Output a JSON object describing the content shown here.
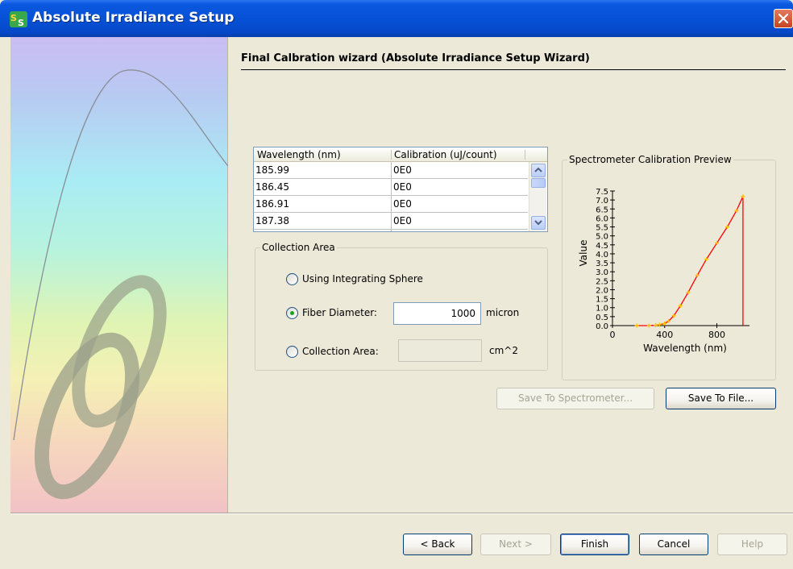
{
  "window": {
    "title": "Absolute Irradiance Setup",
    "icon": "spectrasuite-app-icon",
    "close_icon": "close-icon"
  },
  "wizard": {
    "title": "Final Calbration wizard (Absolute Irradiance Setup Wizard)"
  },
  "table": {
    "columns": [
      "Wavelength (nm)",
      "Calibration (uJ/count)"
    ],
    "rows": [
      [
        "185.99",
        "0E0"
      ],
      [
        "186.45",
        "0E0"
      ],
      [
        "186.91",
        "0E0"
      ],
      [
        "187.38",
        "0E0"
      ]
    ]
  },
  "collection_area": {
    "legend": "Collection Area",
    "options": {
      "integrating_sphere": "Using Integrating Sphere",
      "fiber_diameter": "Fiber Diameter:",
      "collection_area": "Collection Area:"
    },
    "selected": "fiber_diameter",
    "fiber_diameter_value": "1000",
    "fiber_unit": "micron",
    "area_value": "",
    "area_unit": "cm^2"
  },
  "chart_data": {
    "type": "line",
    "title": "Spectrometer Calibration Preview",
    "xlabel": "Wavelength (nm)",
    "ylabel": "Value",
    "xlim": [
      0,
      1050
    ],
    "ylim": [
      0,
      7.5
    ],
    "x_ticks": [
      "0",
      "400",
      "800"
    ],
    "x_tick_values": [
      0,
      400,
      800
    ],
    "y_ticks": [
      "0.0",
      "0.5",
      "1.0",
      "1.5",
      "2.0",
      "2.5",
      "3.0",
      "3.5",
      "4.0",
      "4.5",
      "5.0",
      "5.5",
      "6.0",
      "6.5",
      "7.0",
      "7.5"
    ],
    "y_tick_values": [
      0,
      0.5,
      1,
      1.5,
      2,
      2.5,
      3,
      3.5,
      4,
      4.5,
      5,
      5.5,
      6,
      6.5,
      7,
      7.5
    ],
    "x": [
      186,
      280,
      330,
      360,
      400,
      430,
      470,
      520,
      580,
      650,
      720,
      800,
      880,
      950,
      1000,
      1000
    ],
    "y": [
      0,
      0,
      0.02,
      0.05,
      0.12,
      0.25,
      0.55,
      1.1,
      1.85,
      2.8,
      3.7,
      4.6,
      5.5,
      6.4,
      7.2,
      0
    ],
    "grid": false,
    "colors": {
      "line": "#ff0000",
      "marker": "#ffc000"
    }
  },
  "buttons": {
    "save_to_spectrometer": "Save To Spectrometer...",
    "save_to_file": "Save To File...",
    "back": "< Back",
    "next": "Next >",
    "finish": "Finish",
    "cancel": "Cancel",
    "help": "Help"
  }
}
